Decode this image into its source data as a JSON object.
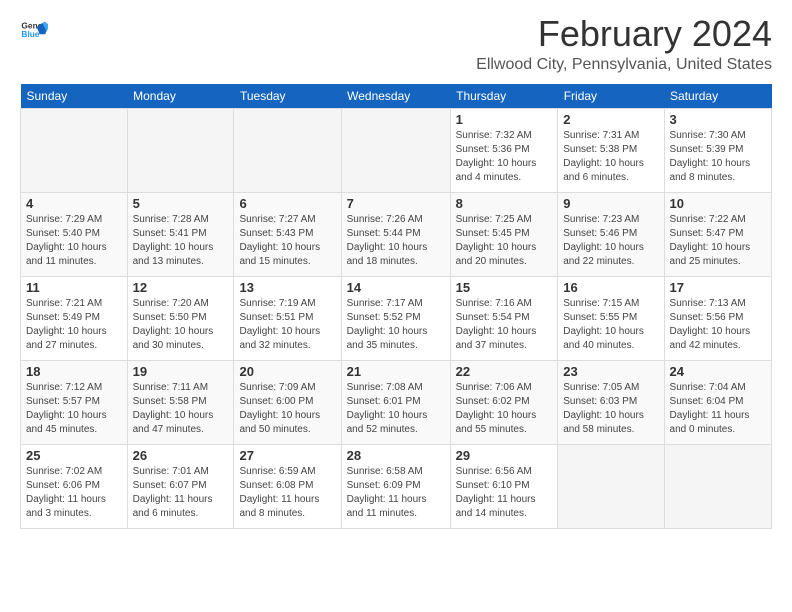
{
  "logo": {
    "text_general": "General",
    "text_blue": "Blue"
  },
  "title": "February 2024",
  "subtitle": "Ellwood City, Pennsylvania, United States",
  "days_of_week": [
    "Sunday",
    "Monday",
    "Tuesday",
    "Wednesday",
    "Thursday",
    "Friday",
    "Saturday"
  ],
  "weeks": [
    [
      {
        "day": "",
        "info": ""
      },
      {
        "day": "",
        "info": ""
      },
      {
        "day": "",
        "info": ""
      },
      {
        "day": "",
        "info": ""
      },
      {
        "day": "1",
        "info": "Sunrise: 7:32 AM\nSunset: 5:36 PM\nDaylight: 10 hours\nand 4 minutes."
      },
      {
        "day": "2",
        "info": "Sunrise: 7:31 AM\nSunset: 5:38 PM\nDaylight: 10 hours\nand 6 minutes."
      },
      {
        "day": "3",
        "info": "Sunrise: 7:30 AM\nSunset: 5:39 PM\nDaylight: 10 hours\nand 8 minutes."
      }
    ],
    [
      {
        "day": "4",
        "info": "Sunrise: 7:29 AM\nSunset: 5:40 PM\nDaylight: 10 hours\nand 11 minutes."
      },
      {
        "day": "5",
        "info": "Sunrise: 7:28 AM\nSunset: 5:41 PM\nDaylight: 10 hours\nand 13 minutes."
      },
      {
        "day": "6",
        "info": "Sunrise: 7:27 AM\nSunset: 5:43 PM\nDaylight: 10 hours\nand 15 minutes."
      },
      {
        "day": "7",
        "info": "Sunrise: 7:26 AM\nSunset: 5:44 PM\nDaylight: 10 hours\nand 18 minutes."
      },
      {
        "day": "8",
        "info": "Sunrise: 7:25 AM\nSunset: 5:45 PM\nDaylight: 10 hours\nand 20 minutes."
      },
      {
        "day": "9",
        "info": "Sunrise: 7:23 AM\nSunset: 5:46 PM\nDaylight: 10 hours\nand 22 minutes."
      },
      {
        "day": "10",
        "info": "Sunrise: 7:22 AM\nSunset: 5:47 PM\nDaylight: 10 hours\nand 25 minutes."
      }
    ],
    [
      {
        "day": "11",
        "info": "Sunrise: 7:21 AM\nSunset: 5:49 PM\nDaylight: 10 hours\nand 27 minutes."
      },
      {
        "day": "12",
        "info": "Sunrise: 7:20 AM\nSunset: 5:50 PM\nDaylight: 10 hours\nand 30 minutes."
      },
      {
        "day": "13",
        "info": "Sunrise: 7:19 AM\nSunset: 5:51 PM\nDaylight: 10 hours\nand 32 minutes."
      },
      {
        "day": "14",
        "info": "Sunrise: 7:17 AM\nSunset: 5:52 PM\nDaylight: 10 hours\nand 35 minutes."
      },
      {
        "day": "15",
        "info": "Sunrise: 7:16 AM\nSunset: 5:54 PM\nDaylight: 10 hours\nand 37 minutes."
      },
      {
        "day": "16",
        "info": "Sunrise: 7:15 AM\nSunset: 5:55 PM\nDaylight: 10 hours\nand 40 minutes."
      },
      {
        "day": "17",
        "info": "Sunrise: 7:13 AM\nSunset: 5:56 PM\nDaylight: 10 hours\nand 42 minutes."
      }
    ],
    [
      {
        "day": "18",
        "info": "Sunrise: 7:12 AM\nSunset: 5:57 PM\nDaylight: 10 hours\nand 45 minutes."
      },
      {
        "day": "19",
        "info": "Sunrise: 7:11 AM\nSunset: 5:58 PM\nDaylight: 10 hours\nand 47 minutes."
      },
      {
        "day": "20",
        "info": "Sunrise: 7:09 AM\nSunset: 6:00 PM\nDaylight: 10 hours\nand 50 minutes."
      },
      {
        "day": "21",
        "info": "Sunrise: 7:08 AM\nSunset: 6:01 PM\nDaylight: 10 hours\nand 52 minutes."
      },
      {
        "day": "22",
        "info": "Sunrise: 7:06 AM\nSunset: 6:02 PM\nDaylight: 10 hours\nand 55 minutes."
      },
      {
        "day": "23",
        "info": "Sunrise: 7:05 AM\nSunset: 6:03 PM\nDaylight: 10 hours\nand 58 minutes."
      },
      {
        "day": "24",
        "info": "Sunrise: 7:04 AM\nSunset: 6:04 PM\nDaylight: 11 hours\nand 0 minutes."
      }
    ],
    [
      {
        "day": "25",
        "info": "Sunrise: 7:02 AM\nSunset: 6:06 PM\nDaylight: 11 hours\nand 3 minutes."
      },
      {
        "day": "26",
        "info": "Sunrise: 7:01 AM\nSunset: 6:07 PM\nDaylight: 11 hours\nand 6 minutes."
      },
      {
        "day": "27",
        "info": "Sunrise: 6:59 AM\nSunset: 6:08 PM\nDaylight: 11 hours\nand 8 minutes."
      },
      {
        "day": "28",
        "info": "Sunrise: 6:58 AM\nSunset: 6:09 PM\nDaylight: 11 hours\nand 11 minutes."
      },
      {
        "day": "29",
        "info": "Sunrise: 6:56 AM\nSunset: 6:10 PM\nDaylight: 11 hours\nand 14 minutes."
      },
      {
        "day": "",
        "info": ""
      },
      {
        "day": "",
        "info": ""
      }
    ]
  ]
}
